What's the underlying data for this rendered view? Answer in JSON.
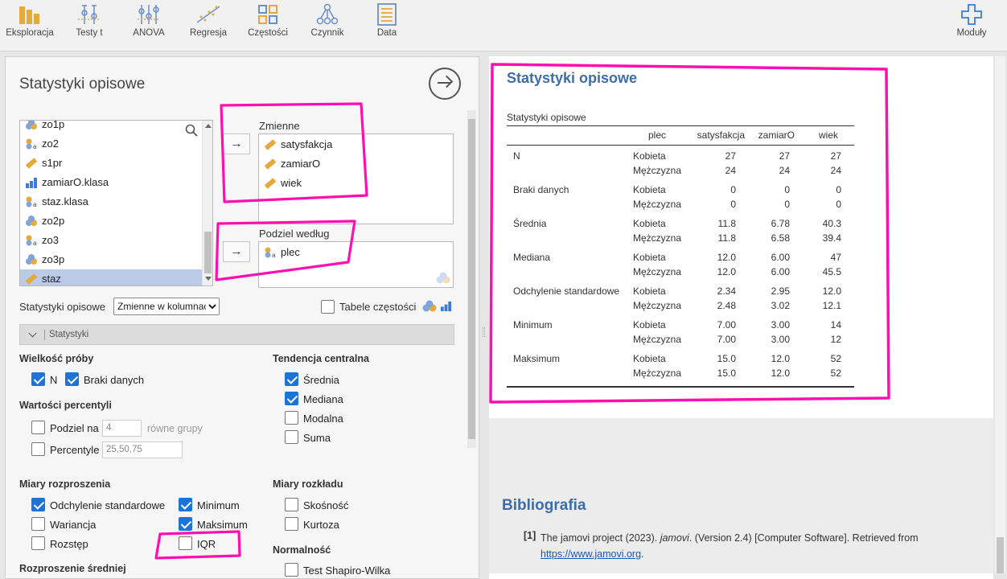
{
  "toolbar": {
    "items": [
      {
        "label": "Eksploracja",
        "icon": "bar-chart-icon"
      },
      {
        "label": "Testy t",
        "icon": "t-test-icon"
      },
      {
        "label": "ANOVA",
        "icon": "anova-icon"
      },
      {
        "label": "Regresja",
        "icon": "regression-icon"
      },
      {
        "label": "Częstości",
        "icon": "frequencies-icon"
      },
      {
        "label": "Czynnik",
        "icon": "factor-icon"
      },
      {
        "label": "Data",
        "icon": "data-icon"
      }
    ],
    "modules_label": "Moduły"
  },
  "options_panel": {
    "title": "Statystyki opisowe",
    "variables": [
      "zo1p",
      "zo2",
      "s1pr",
      "zamiarO.klasa",
      "staz.klasa",
      "zo2p",
      "zo3",
      "zo3p",
      "staz"
    ],
    "selected_variable": "staz",
    "target_variables_label": "Zmienne",
    "target_variables": [
      "satysfakcja",
      "zamiarO",
      "wiek"
    ],
    "split_by_label": "Podziel według",
    "split_by": [
      "plec"
    ],
    "layout_label": "Statystyki opisowe",
    "layout_selected": "Zmienne w kolumnach",
    "freq_tables_label": "Tabele częstości",
    "freq_tables_checked": false,
    "section_label": "Statystyki",
    "sample_size": {
      "heading": "Wielkość próby",
      "n_label": "N",
      "n_checked": true,
      "missing_label": "Braki danych",
      "missing_checked": true
    },
    "percentiles": {
      "heading": "Wartości percentyli",
      "split_label": "Podziel na",
      "split_value": "4",
      "split_suffix": "równe grupy",
      "split_checked": false,
      "pc_label": "Percentyle",
      "pc_value": "25,50,75",
      "pc_checked": false
    },
    "dispersion": {
      "heading": "Miary rozproszenia",
      "sd_label": "Odchylenie standardowe",
      "sd_checked": true,
      "var_label": "Wariancja",
      "var_checked": false,
      "range_label": "Rozstęp",
      "range_checked": false,
      "min_label": "Minimum",
      "min_checked": true,
      "max_label": "Maksimum",
      "max_checked": true,
      "iqr_label": "IQR",
      "iqr_checked": false
    },
    "central": {
      "heading": "Tendencja centralna",
      "mean_label": "Średnia",
      "mean_checked": true,
      "median_label": "Mediana",
      "median_checked": true,
      "mode_label": "Modalna",
      "mode_checked": false,
      "sum_label": "Suma",
      "sum_checked": false
    },
    "distribution": {
      "heading": "Miary rozkładu",
      "skew_label": "Skośność",
      "skew_checked": false,
      "kurt_label": "Kurtoza",
      "kurt_checked": false
    },
    "normality": {
      "heading": "Normalność",
      "sw_label": "Test Shapiro-Wilka",
      "sw_checked": false
    },
    "mean_dispersion": {
      "heading": "Rozproszenie średniej"
    }
  },
  "results": {
    "title": "Statystyki opisowe",
    "table_title": "Statystyki opisowe",
    "columns": [
      "plec",
      "satysfakcja",
      "zamiarO",
      "wiek"
    ],
    "rows": [
      {
        "stat": "N",
        "groups": [
          [
            "Kobieta",
            "27",
            "27",
            "27"
          ],
          [
            "Mężczyzna",
            "24",
            "24",
            "24"
          ]
        ]
      },
      {
        "stat": "Braki danych",
        "groups": [
          [
            "Kobieta",
            "0",
            "0",
            "0"
          ],
          [
            "Mężczyzna",
            "0",
            "0",
            "0"
          ]
        ]
      },
      {
        "stat": "Średnia",
        "groups": [
          [
            "Kobieta",
            "11.8",
            "6.78",
            "40.3"
          ],
          [
            "Mężczyzna",
            "11.8",
            "6.58",
            "39.4"
          ]
        ]
      },
      {
        "stat": "Mediana",
        "groups": [
          [
            "Kobieta",
            "12.0",
            "6.00",
            "47"
          ],
          [
            "Mężczyzna",
            "12.0",
            "6.00",
            "45.5"
          ]
        ]
      },
      {
        "stat": "Odchylenie standardowe",
        "groups": [
          [
            "Kobieta",
            "2.34",
            "2.95",
            "12.0"
          ],
          [
            "Mężczyzna",
            "2.48",
            "3.02",
            "12.1"
          ]
        ]
      },
      {
        "stat": "Minimum",
        "groups": [
          [
            "Kobieta",
            "7.00",
            "3.00",
            "14"
          ],
          [
            "Mężczyzna",
            "7.00",
            "3.00",
            "12"
          ]
        ]
      },
      {
        "stat": "Maksimum",
        "groups": [
          [
            "Kobieta",
            "15.0",
            "12.0",
            "52"
          ],
          [
            "Mężczyzna",
            "15.0",
            "12.0",
            "52"
          ]
        ]
      }
    ],
    "bibliography": {
      "title": "Bibliografia",
      "number": "[1]",
      "text_before": "The jamovi project (2023). ",
      "text_italic": "jamovi",
      "text_after": ". (Version 2.4) [Computer Software]. Retrieved from",
      "link": "https://www.jamovi.org",
      "link_suffix": "."
    }
  },
  "colors": {
    "accent": "#3e6da8",
    "checkbox": "#1e73d6",
    "highlight": "#ff0fb0",
    "selected_row": "#b9cbe6"
  }
}
